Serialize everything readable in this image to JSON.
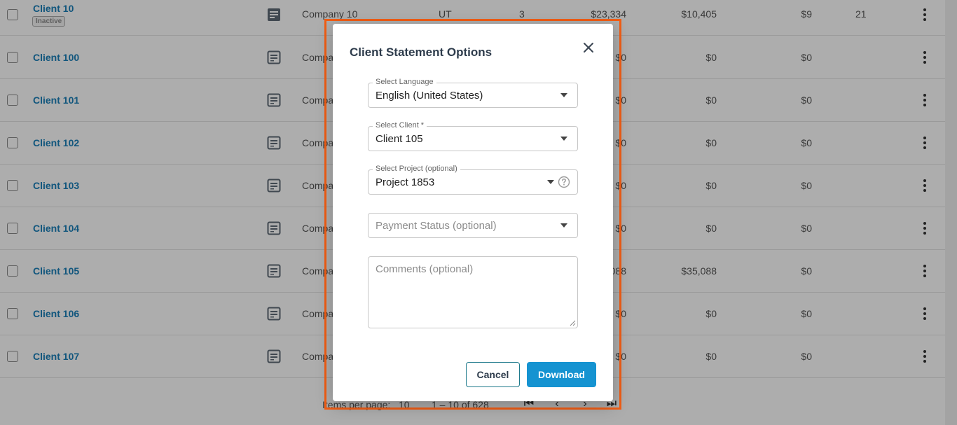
{
  "table": {
    "rows": [
      {
        "name": "Client 10",
        "badge": "Inactive",
        "company": "Company 10",
        "state": "UT",
        "count": "3",
        "amount1": "$23,334",
        "amount2": "$10,405",
        "amount3": "$9",
        "extra": "21"
      },
      {
        "name": "Client 100",
        "company": "Compa",
        "amount1": "$0",
        "amount2": "$0",
        "amount3": "$0"
      },
      {
        "name": "Client 101",
        "company": "Compa",
        "amount1": "$0",
        "amount2": "$0",
        "amount3": "$0"
      },
      {
        "name": "Client 102",
        "company": "Compa",
        "amount1": "$0",
        "amount2": "$0",
        "amount3": "$0"
      },
      {
        "name": "Client 103",
        "company": "Compa",
        "amount1": "$0",
        "amount2": "$0",
        "amount3": "$0"
      },
      {
        "name": "Client 104",
        "company": "Compa",
        "amount1": "$0",
        "amount2": "$0",
        "amount3": "$0"
      },
      {
        "name": "Client 105",
        "company": "Compa",
        "amount1": "088",
        "amount2": "$35,088",
        "amount3": "$0"
      },
      {
        "name": "Client 106",
        "company": "Compa",
        "amount1": "$0",
        "amount2": "$0",
        "amount3": "$0"
      },
      {
        "name": "Client 107",
        "company": "Compa",
        "amount1": "$0",
        "amount2": "$0",
        "amount3": "$0"
      }
    ]
  },
  "pagination": {
    "items_per_page_label": "Items per page:",
    "items_per_page": "10",
    "range": "1 – 10 of 628"
  },
  "icons": {
    "note": "note-icon",
    "menu": "more-vertical-icon",
    "close": "close-icon",
    "caret": "caret-down-icon",
    "help": "help-circle-icon"
  },
  "colors": {
    "link": "#1a7fb8",
    "primary": "#1593d1",
    "highlight": "#f25d14",
    "title": "#2e3c4c"
  },
  "dialog": {
    "title": "Client Statement Options",
    "language": {
      "label": "Select Language",
      "value": "English (United States)"
    },
    "client": {
      "label": "Select Client *",
      "value": "Client 105"
    },
    "project": {
      "label": "Select Project (optional)",
      "value": "Project 1853"
    },
    "payment_status": {
      "placeholder": "Payment Status (optional)"
    },
    "comments": {
      "placeholder": "Comments (optional)"
    },
    "cancel_label": "Cancel",
    "download_label": "Download"
  }
}
